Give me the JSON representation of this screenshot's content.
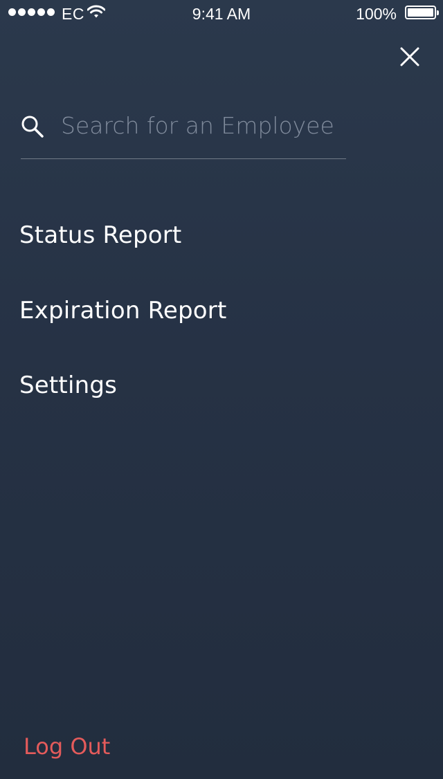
{
  "status_bar": {
    "carrier": "EC",
    "time": "9:41 AM",
    "battery_percent": "100%",
    "battery_level": 1.0,
    "signal_bars": 5,
    "icons": [
      "signal-dots-icon",
      "wifi-icon",
      "battery-icon"
    ]
  },
  "header": {
    "close_icon": "close-icon"
  },
  "search": {
    "value": "",
    "placeholder": "Search for an Employee",
    "icon": "search-icon"
  },
  "menu": {
    "items": [
      {
        "label": "Status Report"
      },
      {
        "label": "Expiration Report"
      },
      {
        "label": "Settings"
      }
    ]
  },
  "footer": {
    "logout_label": "Log Out"
  },
  "colors": {
    "background_top": "#2b394c",
    "background_bottom": "#222d3e",
    "text_primary": "#ffffff",
    "placeholder": "#808b9c",
    "logout": "#e45b5b"
  }
}
